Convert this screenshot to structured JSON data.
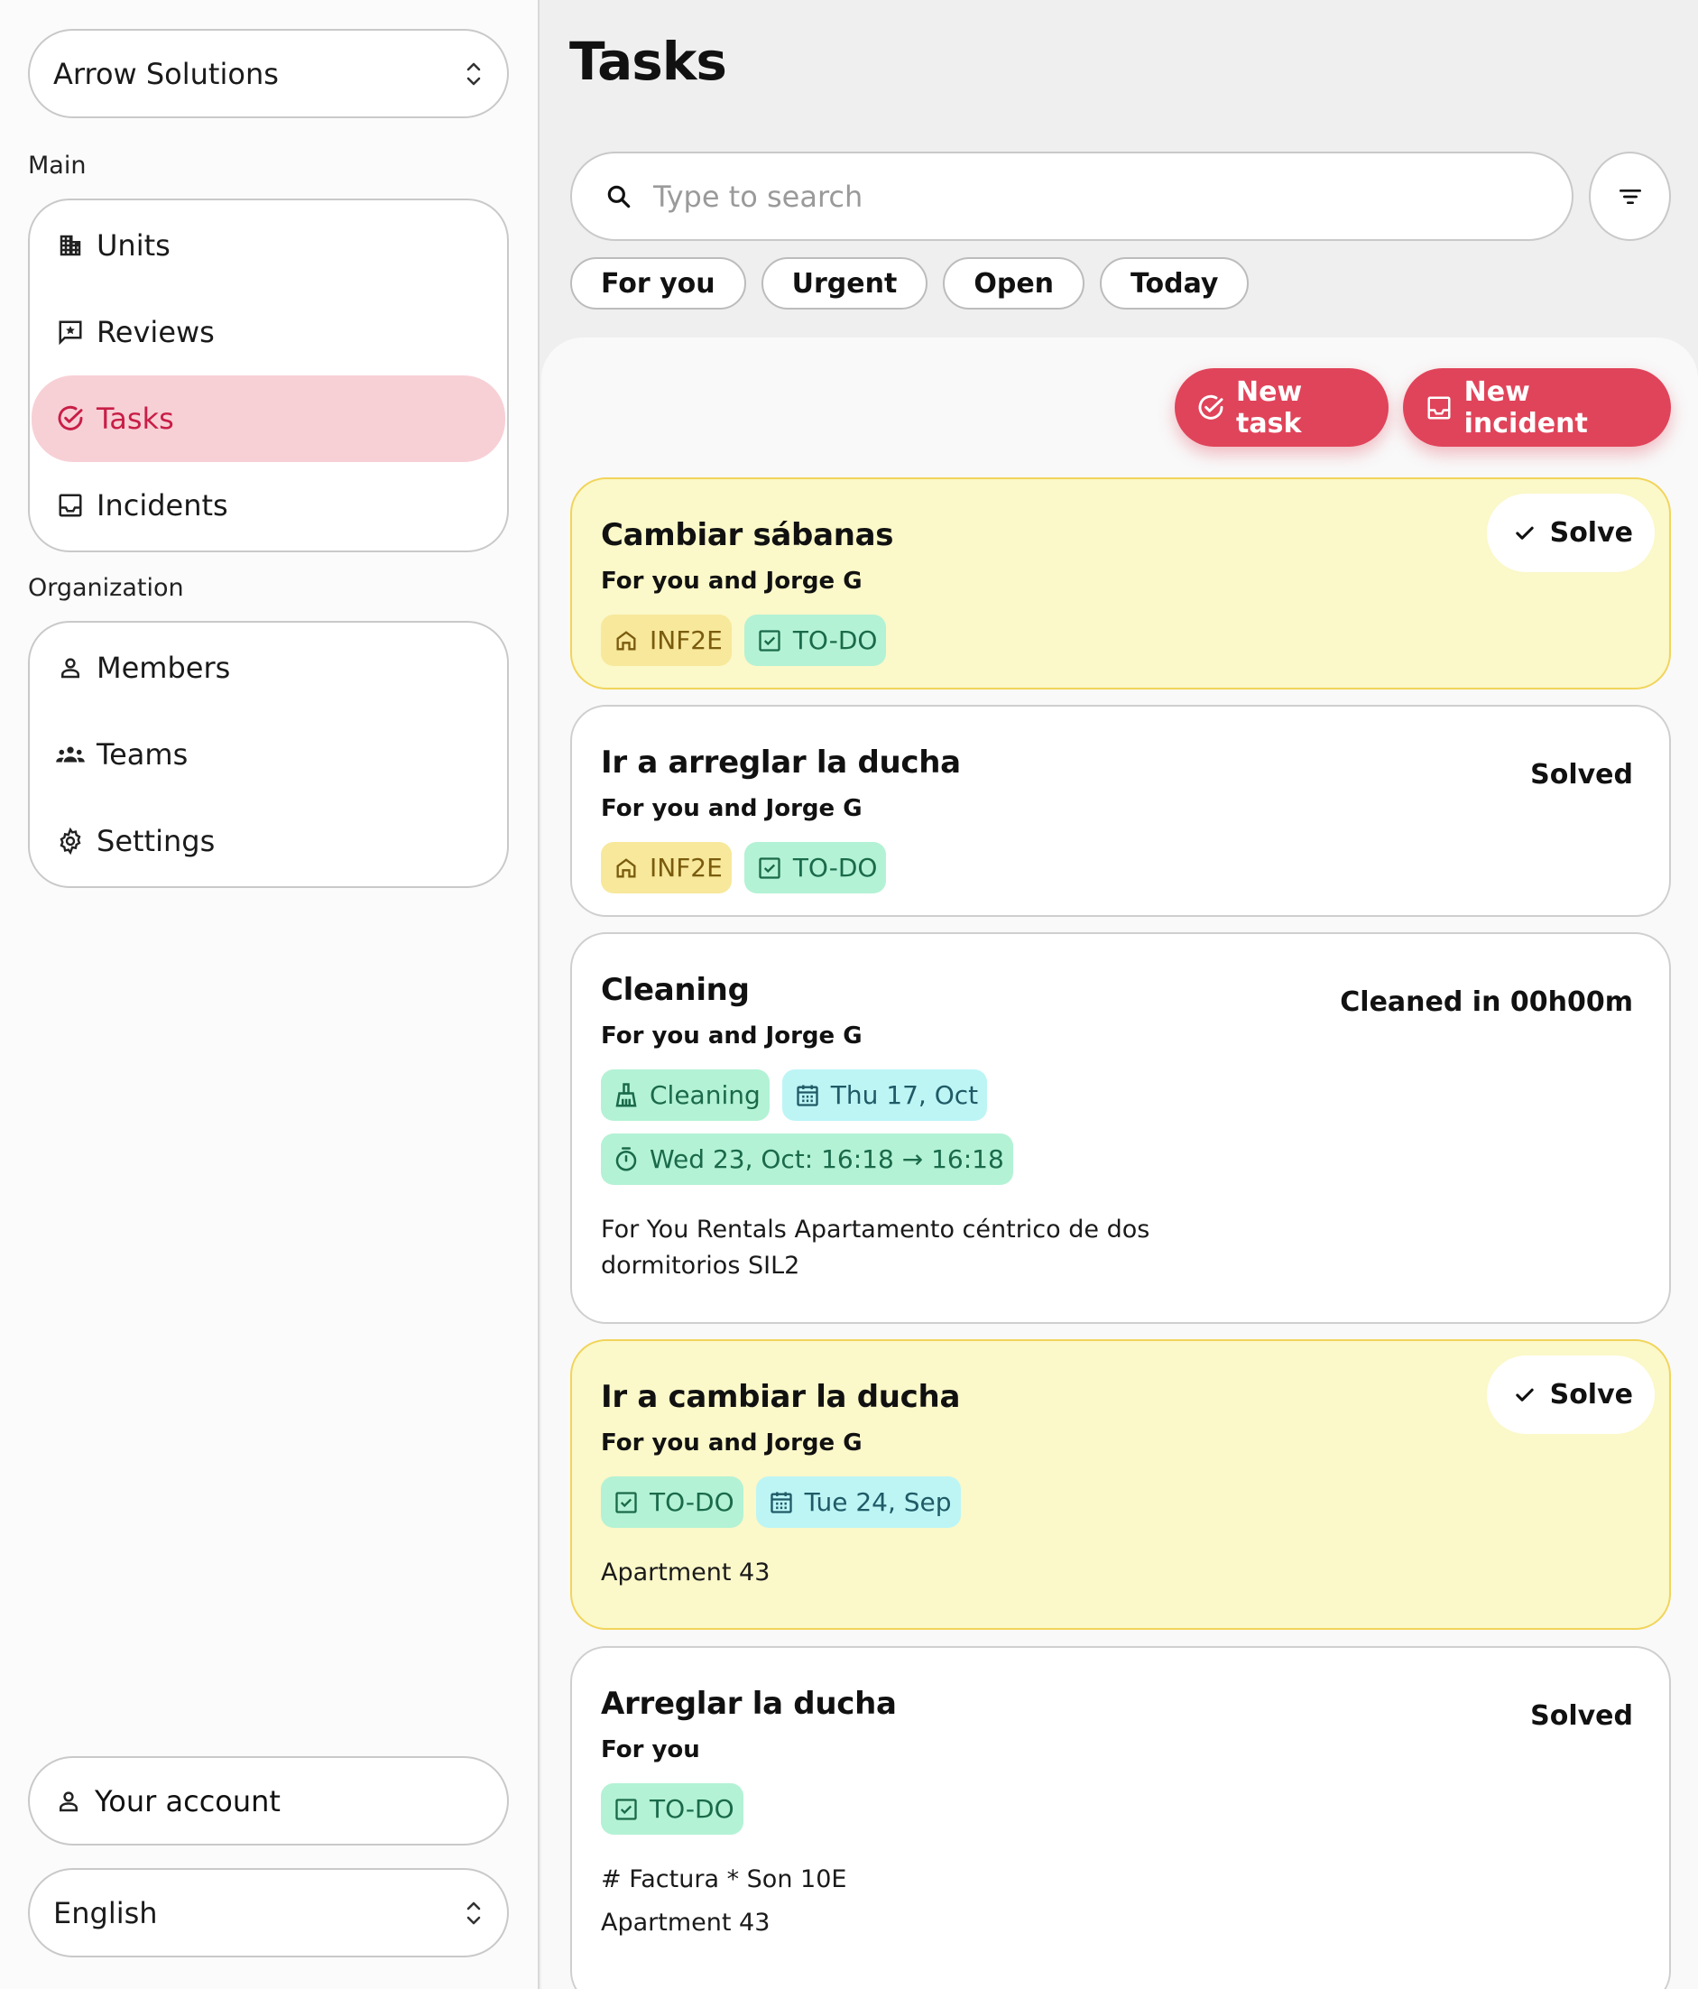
{
  "organization": {
    "name": "Arrow Solutions"
  },
  "sidebar": {
    "main_title": "Main",
    "main_items": [
      {
        "label": "Units",
        "icon": "building-icon"
      },
      {
        "label": "Reviews",
        "icon": "review-icon"
      },
      {
        "label": "Tasks",
        "icon": "check-circle-icon",
        "active": true
      },
      {
        "label": "Incidents",
        "icon": "inbox-icon"
      }
    ],
    "org_title": "Organization",
    "org_items": [
      {
        "label": "Members",
        "icon": "user-icon"
      },
      {
        "label": "Teams",
        "icon": "team-icon"
      },
      {
        "label": "Settings",
        "icon": "gear-icon"
      }
    ],
    "account_label": "Your account",
    "language": "English"
  },
  "header": {
    "title": "Tasks"
  },
  "search": {
    "placeholder": "Type to search",
    "value": ""
  },
  "quick_filters": [
    "For you",
    "Urgent",
    "Open",
    "Today"
  ],
  "actions": {
    "new_task": "New task",
    "new_incident": "New incident"
  },
  "tasks": [
    {
      "title": "Cambiar sábanas",
      "assignee": "For you and Jorge G",
      "tags": [
        {
          "label": "INF2E",
          "color": "yellow",
          "icon": "home-icon"
        },
        {
          "label": "TO-DO",
          "color": "green",
          "icon": "checkbox-icon"
        }
      ],
      "action_label": "Solve",
      "urgent": true
    },
    {
      "title": "Ir a arreglar la ducha",
      "assignee": "For you and Jorge G",
      "tags": [
        {
          "label": "INF2E",
          "color": "yellow",
          "icon": "home-icon"
        },
        {
          "label": "TO-DO",
          "color": "green",
          "icon": "checkbox-icon"
        }
      ],
      "status": "Solved"
    },
    {
      "title": "Cleaning",
      "assignee": "For you and Jorge G",
      "tags": [
        {
          "label": "Cleaning",
          "color": "green",
          "icon": "broom-icon"
        },
        {
          "label": "Thu 17, Oct",
          "color": "cyan",
          "icon": "calendar-icon"
        }
      ],
      "tags_row2": [
        {
          "label": "Wed 23, Oct: 16:18 → 16:18",
          "color": "green",
          "icon": "timer-icon"
        }
      ],
      "status": "Cleaned in 00h00m",
      "description": [
        "For You Rentals Apartamento céntrico de dos",
        "dormitorios SIL2"
      ]
    },
    {
      "title": "Ir a cambiar la ducha",
      "assignee": "For you and Jorge G",
      "tags": [
        {
          "label": "TO-DO",
          "color": "green",
          "icon": "checkbox-icon"
        },
        {
          "label": "Tue 24, Sep",
          "color": "cyan",
          "icon": "calendar-icon"
        }
      ],
      "action_label": "Solve",
      "urgent": true,
      "description": [
        "Apartment 43"
      ]
    },
    {
      "title": "Arreglar la ducha",
      "assignee": "For you",
      "tags": [
        {
          "label": "TO-DO",
          "color": "green",
          "icon": "checkbox-icon"
        }
      ],
      "status": "Solved",
      "description": [
        "# Factura * Son 10E",
        "Apartment 43"
      ]
    }
  ],
  "colors": {
    "accent": "#e0445a",
    "active_nav_bg": "#f7d0d6",
    "active_nav_text": "#c81e46",
    "urgent_card_bg": "#fbf8c9",
    "urgent_card_border": "#f1d45a",
    "tag_yellow": "#f7e89b",
    "tag_green": "#b3f2d5",
    "tag_cyan": "#bdf5f5"
  }
}
